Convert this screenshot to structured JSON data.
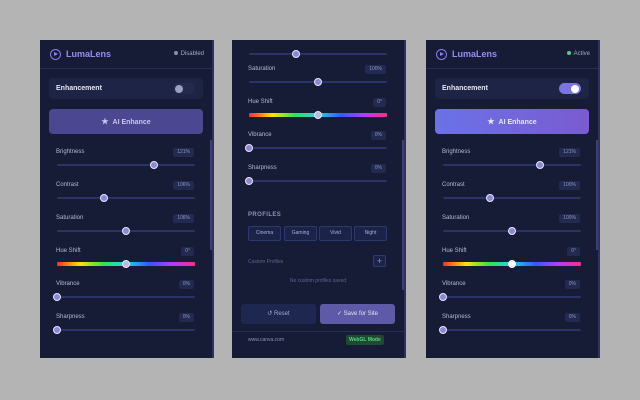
{
  "panels": [
    {
      "app_name": "LumaLens",
      "status": "Disabled",
      "status_color": "#8b8fa8",
      "enhancement_label": "Enhancement",
      "enhancement_on": false,
      "ai_button": "AI Enhance",
      "sliders": [
        {
          "label": "Brightness",
          "value": "121%",
          "level": 0.7
        },
        {
          "label": "Contrast",
          "value": "106%",
          "level": 0.34
        },
        {
          "label": "Saturation",
          "value": "106%",
          "level": 0.5
        },
        {
          "label": "Hue Shift",
          "value": "0°",
          "level": 0.5,
          "hue": true
        },
        {
          "label": "Vibrance",
          "value": "0%",
          "level": 0.0
        },
        {
          "label": "Sharpness",
          "value": "0%",
          "level": 0.0
        }
      ]
    },
    {
      "sliders": [
        {
          "label": "Saturation",
          "value": "100%",
          "level": 0.5
        },
        {
          "label": "Hue Shift",
          "value": "0°",
          "level": 0.5,
          "hue": true
        },
        {
          "label": "Vibrance",
          "value": "0%",
          "level": 0.0
        },
        {
          "label": "Sharpness",
          "value": "0%",
          "level": 0.0
        }
      ],
      "profiles_title": "PROFILES",
      "presets": [
        "Cinema",
        "Gaming",
        "Vivid",
        "Night"
      ],
      "custom_profiles_label": "Custom Profiles",
      "add_symbol": "+",
      "empty_message": "No custom profiles saved",
      "reset_label": "Reset",
      "save_label": "Save for Site",
      "site": "www.canva.com",
      "mode_badge": "WebGL Mode"
    },
    {
      "app_name": "LumaLens",
      "status": "Active",
      "status_color": "#3fd67c",
      "enhancement_label": "Enhancement",
      "enhancement_on": true,
      "ai_button": "AI Enhance",
      "sliders": [
        {
          "label": "Brightness",
          "value": "121%",
          "level": 0.7
        },
        {
          "label": "Contrast",
          "value": "100%",
          "level": 0.34
        },
        {
          "label": "Saturation",
          "value": "100%",
          "level": 0.5
        },
        {
          "label": "Hue Shift",
          "value": "0°",
          "level": 0.5,
          "hue": true
        },
        {
          "label": "Vibrance",
          "value": "0%",
          "level": 0.0
        },
        {
          "label": "Sharpness",
          "value": "0%",
          "level": 0.0
        }
      ]
    }
  ],
  "colors": {
    "accent": "#8b7cf0",
    "ai_disabled": "#4b4790",
    "ai_active_start": "#6b72e8",
    "ai_active_end": "#7a5bd0",
    "toggle_off": "#232a50",
    "toggle_on": "#7b74e2"
  },
  "icons": {
    "logo": "play-circle-icon",
    "ai": "star-icon",
    "reset": "undo-icon",
    "save": "check-icon"
  }
}
